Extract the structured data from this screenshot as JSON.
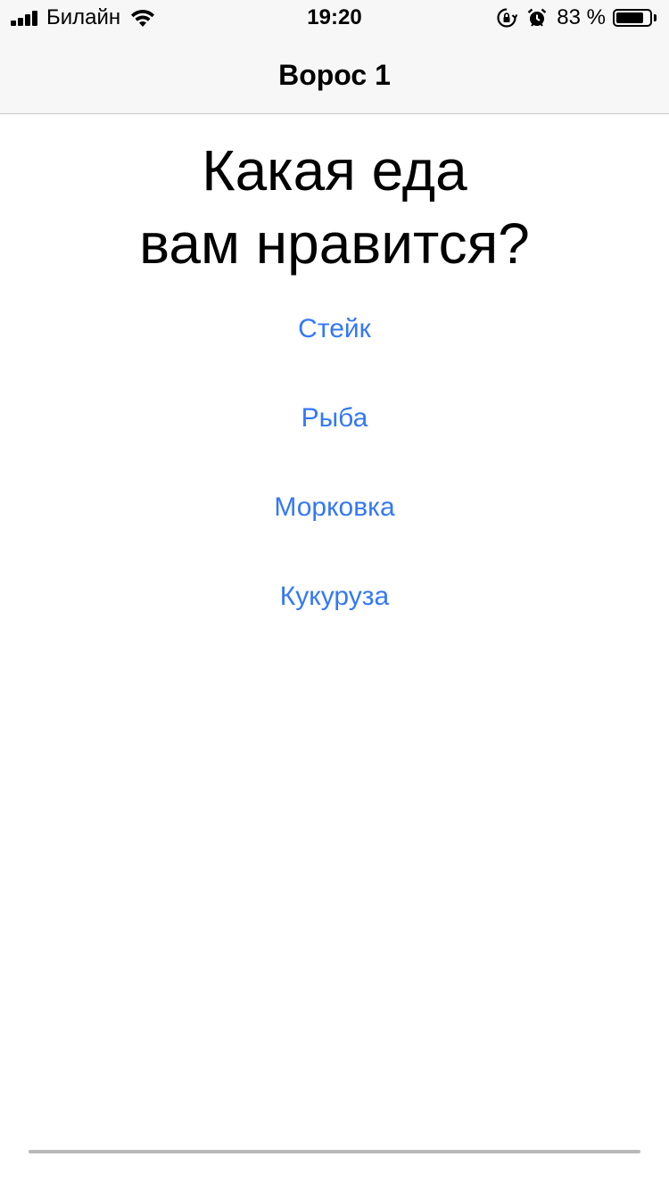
{
  "status_bar": {
    "carrier": "Билайн",
    "time": "19:20",
    "battery_percent": "83 %",
    "battery_level": 0.83,
    "icons": [
      "signal-icon",
      "wifi-icon",
      "orientation-lock-icon",
      "alarm-icon",
      "battery-icon"
    ]
  },
  "nav": {
    "title": "Ворос 1"
  },
  "question": {
    "line1": "Какая еда",
    "line2": "вам нравится?"
  },
  "options": [
    {
      "label": "Стейк"
    },
    {
      "label": "Рыба"
    },
    {
      "label": "Морковка"
    },
    {
      "label": "Кукуруза"
    }
  ],
  "colors": {
    "accent": "#3478f6",
    "bar_background": "#f7f7f7"
  }
}
